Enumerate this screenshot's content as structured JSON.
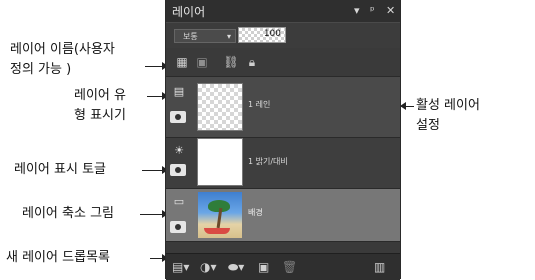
{
  "panel": {
    "title": "레이어",
    "controls": {
      "menu": "▾",
      "pin": "ᵖ",
      "close": "✕"
    },
    "blend_mode": "보통",
    "opacity": "100"
  },
  "annotations": {
    "layer_name": [
      "레이어 이름(사용자",
      "정의 가능 )"
    ],
    "layer_type": [
      "레이어 유",
      "형 표시기"
    ],
    "active_layer": [
      "활성 레이어",
      "설정"
    ],
    "visibility_toggle": "레이어 표시 토글",
    "thumbnail": "레이어 축소 그림",
    "new_layer_dropdown": "새 레이어 드롭목록"
  },
  "layers": [
    {
      "name": "1 레인",
      "type_icon": "layer-type-icon",
      "thumbnail": "transparent"
    },
    {
      "name": "1 밝기/대비",
      "type_icon": "adjustment-icon",
      "thumbnail": "white"
    },
    {
      "name": "배경",
      "type_icon": "background-icon",
      "thumbnail": "photo"
    }
  ],
  "toolbar_icons": [
    "clip-mask-icon",
    "lock-transparency-icon",
    "link-icon",
    "lock-icon"
  ],
  "bottom_icons": [
    "new-layer-icon",
    "adjust-icon",
    "mask-icon",
    "group-icon",
    "delete-icon",
    "settings-icon"
  ],
  "colors": {
    "panel_bg": "#3a3a3a",
    "selected_layer": "#777777",
    "titlebar": "#2f2f2f"
  }
}
